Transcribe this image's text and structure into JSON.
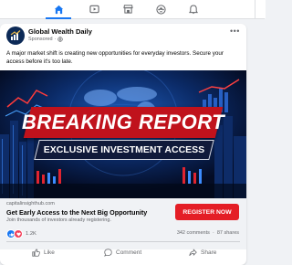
{
  "nav": {
    "tabs": [
      {
        "name": "home",
        "active": true
      },
      {
        "name": "video",
        "active": false
      },
      {
        "name": "marketplace",
        "active": false
      },
      {
        "name": "groups",
        "active": false
      },
      {
        "name": "notifications",
        "active": false
      }
    ],
    "accent_color": "#1877f2"
  },
  "post": {
    "page_name": "Global Wealth Daily",
    "sponsored_label": "Sponsored",
    "more_label": "•••",
    "caption": "A major market shift is creating new opportunities for everyday investors. Secure your access before it's too late.",
    "image": {
      "headline": "BREAKING REPORT",
      "subheadline": "EXCLUSIVE INVESTMENT ACCESS",
      "banner_color": "#c0121c"
    },
    "cta": {
      "domain": "capitalinsighthub.com",
      "headline": "Get Early Access to the Next Big Opportunity",
      "subtext": "Join thousands of investors already registering.",
      "button_label": "REGISTER NOW",
      "button_color": "#e41e26"
    },
    "reactions": {
      "count": "1.2K",
      "comments": "342 comments",
      "shares": "87 shares"
    },
    "actions": {
      "like": "Like",
      "comment": "Comment",
      "share": "Share"
    }
  }
}
